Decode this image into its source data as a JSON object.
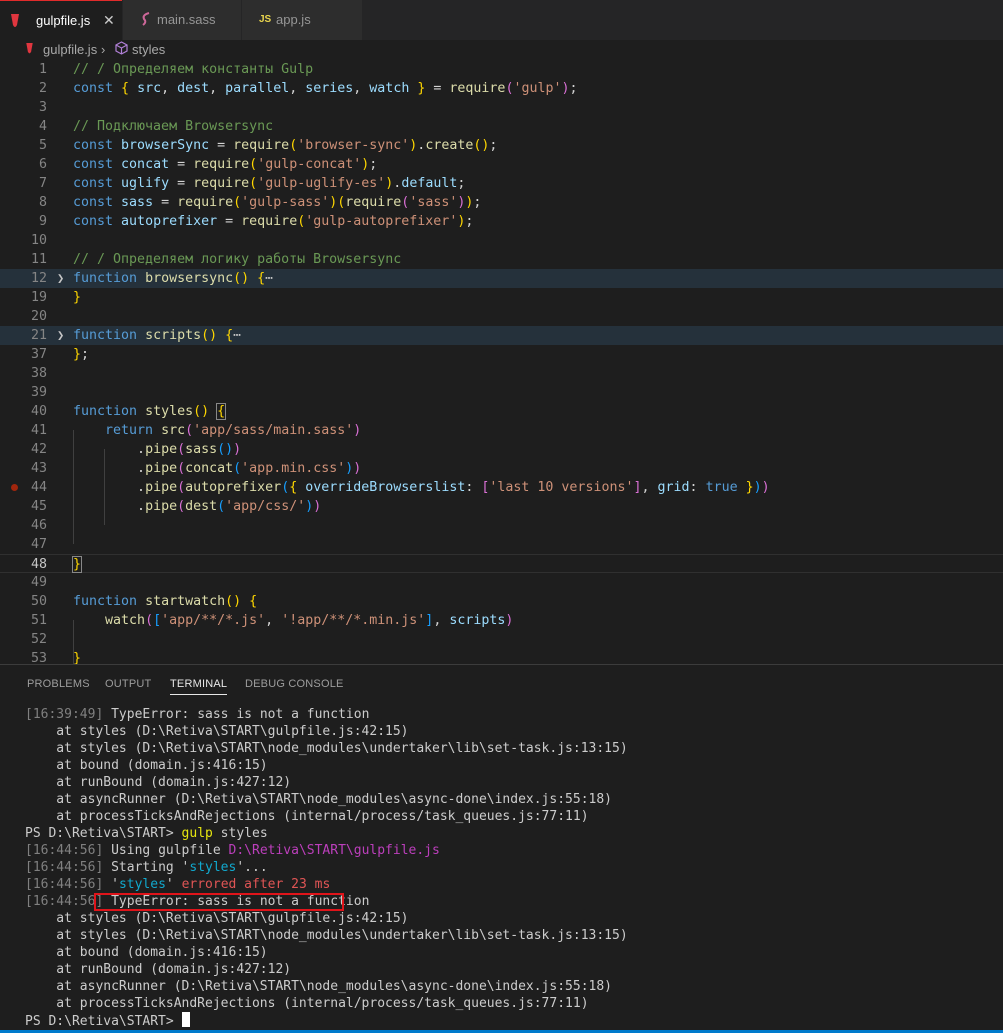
{
  "tabs": [
    {
      "label": "gulpfile.js",
      "icon": "gulp-icon",
      "active": true,
      "close": "✕"
    },
    {
      "label": "main.sass",
      "icon": "sass-icon",
      "active": false
    },
    {
      "label": "app.js",
      "icon": "js-icon",
      "icon_text": "JS",
      "active": false
    }
  ],
  "breadcrumb": {
    "file": "gulpfile.js",
    "separator": "›",
    "symbol": "styles"
  },
  "editor": {
    "line_numbers": [
      "1",
      "2",
      "3",
      "4",
      "5",
      "6",
      "7",
      "8",
      "9",
      "10",
      "11",
      "12",
      "19",
      "20",
      "21",
      "37",
      "38",
      "39",
      "40",
      "41",
      "42",
      "43",
      "44",
      "45",
      "46",
      "47",
      "48",
      "49",
      "50",
      "51",
      "52",
      "53"
    ],
    "lines": {
      "l1": "// / Определяем константы Gulp",
      "l4": "// Подключаем Browsersync",
      "l11": "// / Определяем логику работы Browsersync",
      "ellipsis": "⋯"
    }
  },
  "panel": {
    "tabs": [
      "PROBLEMS",
      "OUTPUT",
      "TERMINAL",
      "DEBUG CONSOLE"
    ],
    "active_tab": "TERMINAL",
    "terminal": {
      "t1_time": "16:39:49",
      "t1_text": "TypeError: sass is not a function",
      "stack": [
        "    at styles (D:\\Retiva\\START\\gulpfile.js:42:15)",
        "    at styles (D:\\Retiva\\START\\node_modules\\undertaker\\lib\\set-task.js:13:15)",
        "    at bound (domain.js:416:15)",
        "    at runBound (domain.js:427:12)",
        "    at asyncRunner (D:\\Retiva\\START\\node_modules\\async-done\\index.js:55:18)",
        "    at processTicksAndRejections (internal/process/task_queues.js:77:11)"
      ],
      "prompt": "PS D:\\Retiva\\START> ",
      "command": "gulp",
      "command_arg": " styles",
      "t2_time": "16:44:56",
      "using_text": " Using gulpfile ",
      "gulpfile_path": "D:\\Retiva\\START\\gulpfile.js",
      "starting_text": " Starting '",
      "task_name": "styles",
      "starting_end": "'...",
      "errored_pre": " '",
      "errored_post": "' ",
      "errored_text": "errored after 23 ms",
      "t2_error": "TypeError: sass is not a function"
    }
  }
}
